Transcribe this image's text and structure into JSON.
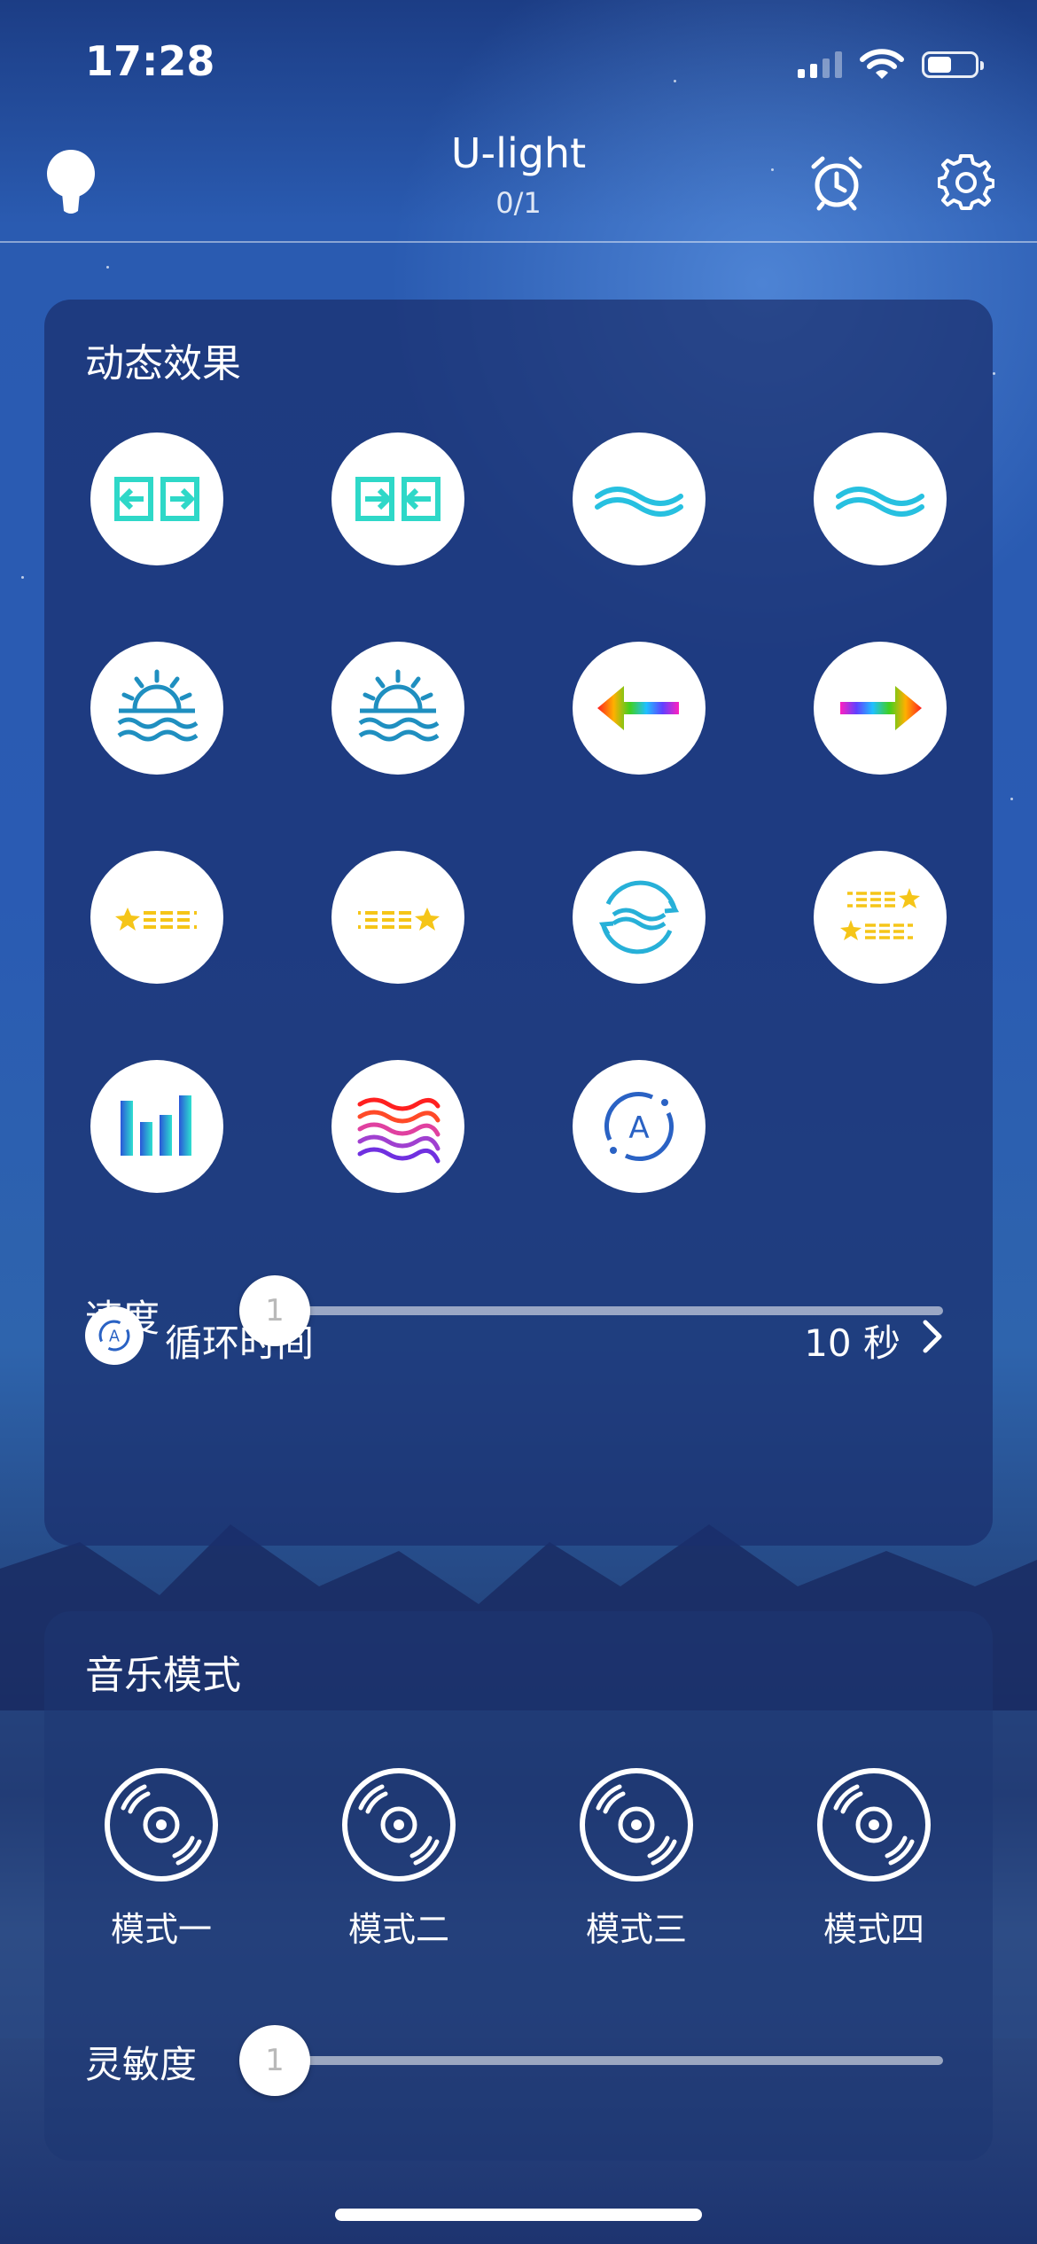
{
  "status_bar": {
    "time": "17:28",
    "signal_bars": 4,
    "signal_active": 2,
    "battery_level": 0.5
  },
  "header": {
    "title": "U-light",
    "subtitle": "0/1",
    "icons": [
      "lightbulb-icon",
      "alarm-clock-icon",
      "gear-icon"
    ]
  },
  "dynamic_effects": {
    "title": "动态效果",
    "effects": [
      {
        "icon": "split-outward-icon"
      },
      {
        "icon": "merge-inward-icon"
      },
      {
        "icon": "wave-icon"
      },
      {
        "icon": "wave-icon"
      },
      {
        "icon": "sunrise-icon"
      },
      {
        "icon": "sunset-icon"
      },
      {
        "icon": "rainbow-arrow-left-icon"
      },
      {
        "icon": "rainbow-arrow-right-icon"
      },
      {
        "icon": "shooting-star-left-icon"
      },
      {
        "icon": "shooting-star-right-icon"
      },
      {
        "icon": "wave-cycle-icon"
      },
      {
        "icon": "double-shooting-star-icon"
      },
      {
        "icon": "equalizer-icon"
      },
      {
        "icon": "rainbow-wave-icon"
      },
      {
        "icon": "auto-cycle-icon"
      }
    ],
    "speed_label": "速度",
    "speed_value": "1",
    "cycle_label": "循环时间",
    "cycle_value": "10 秒"
  },
  "music_mode": {
    "title": "音乐模式",
    "modes": [
      {
        "label": "模式一",
        "icon": "vinyl-disc-icon"
      },
      {
        "label": "模式二",
        "icon": "vinyl-disc-icon"
      },
      {
        "label": "模式三",
        "icon": "vinyl-disc-icon"
      },
      {
        "label": "模式四",
        "icon": "vinyl-disc-icon"
      }
    ],
    "sensitivity_label": "灵敏度",
    "sensitivity_value": "1"
  },
  "colors": {
    "teal_accent": "#2ed8c8",
    "wave_blue": "#27c0e0",
    "star_yellow": "#f5c518",
    "icon_blue": "#2a62c4",
    "card_bg": "#1a2f6e"
  }
}
